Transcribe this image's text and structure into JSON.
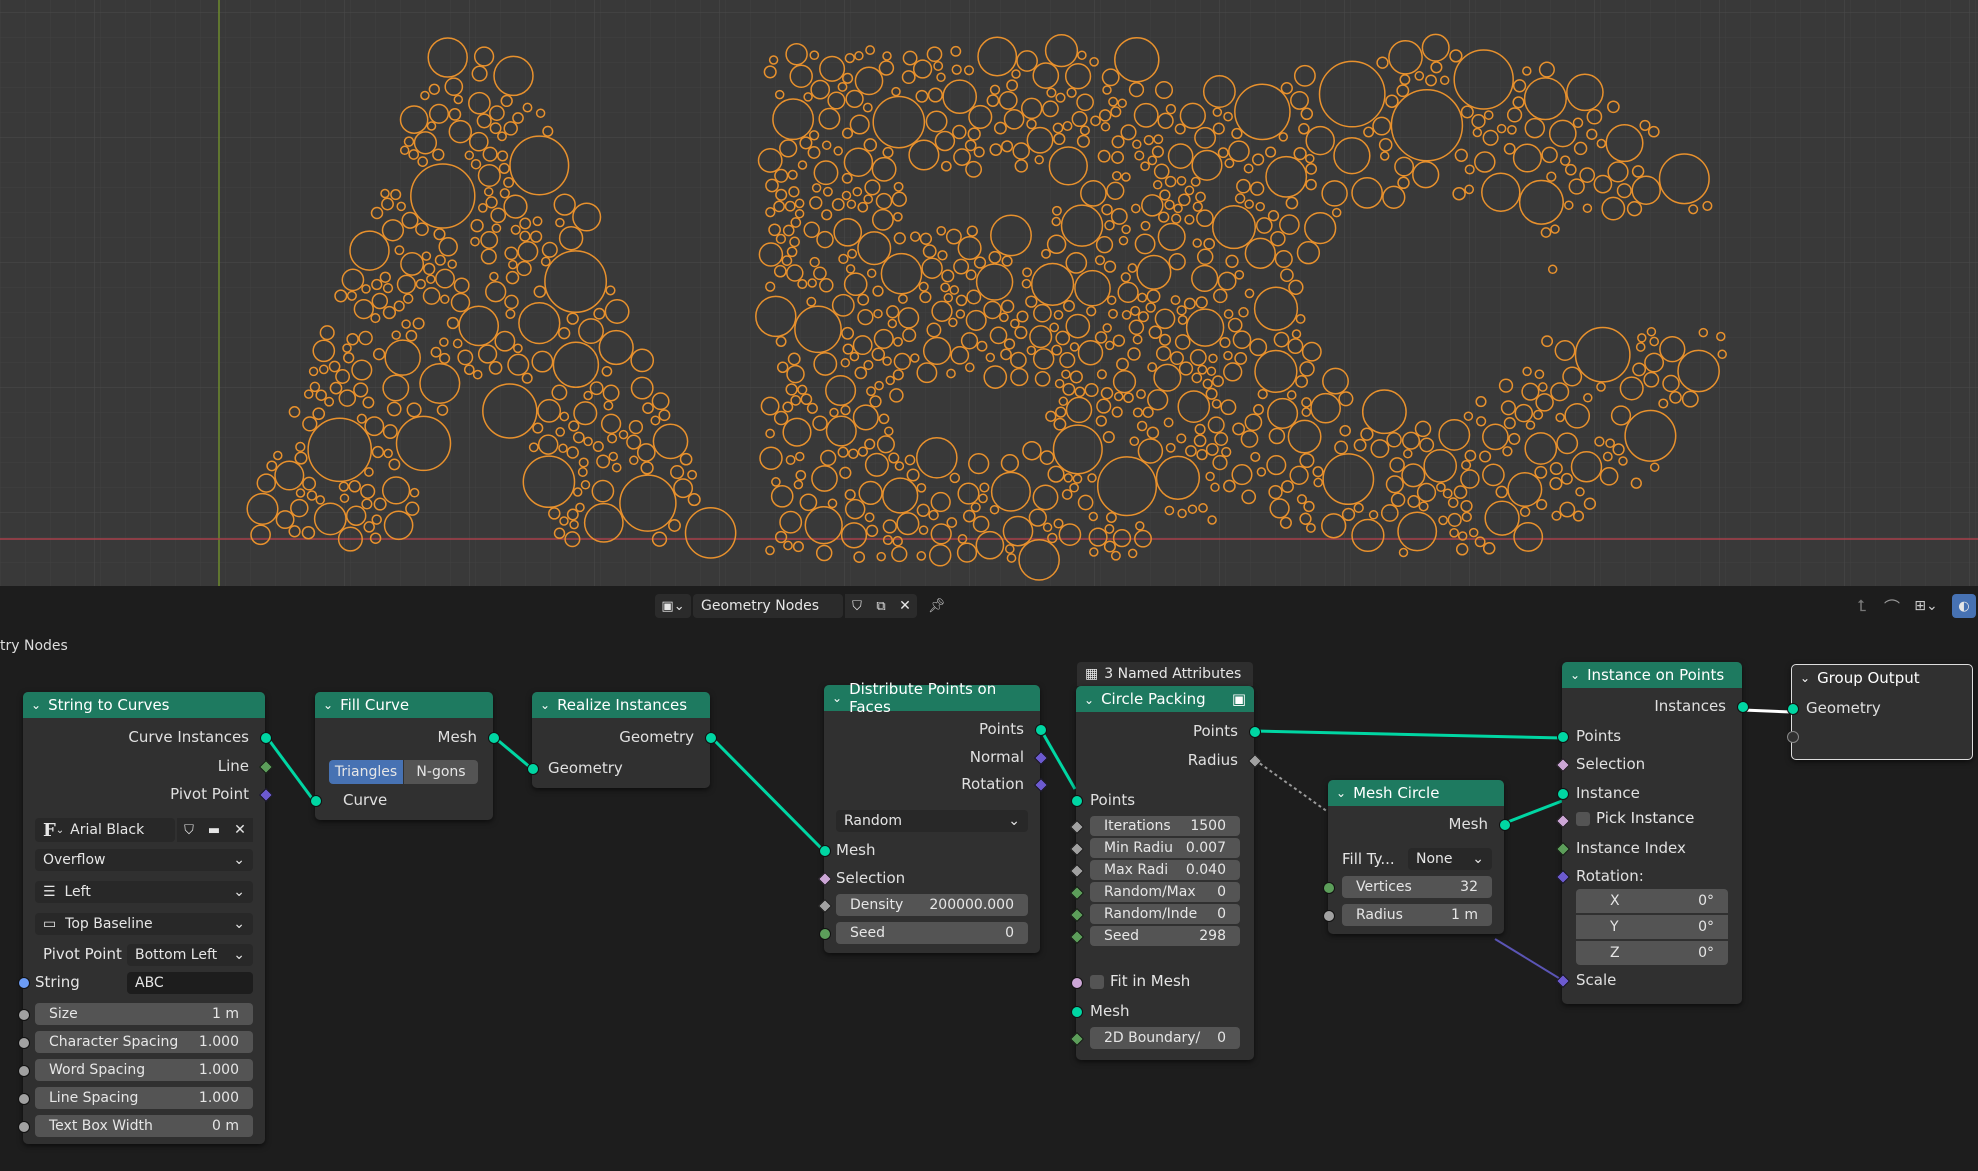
{
  "viewport": {
    "letters": "ABC"
  },
  "header": {
    "editor_type_icon": "node-editor-icon",
    "tree_name": "Geometry Nodes",
    "breadcrumb": "try Nodes"
  },
  "nodes": {
    "string_to_curves": {
      "title": "String to Curves",
      "outputs": [
        "Curve Instances",
        "Line",
        "Pivot Point"
      ],
      "font": "Arial Black",
      "overflow": "Overflow",
      "align_x": "Left",
      "align_y": "Top Baseline",
      "pivot_label": "Pivot Point",
      "pivot_value": "Bottom Left",
      "string_label": "String",
      "string_value": "ABC",
      "fields": [
        {
          "label": "Size",
          "value": "1 m"
        },
        {
          "label": "Character Spacing",
          "value": "1.000"
        },
        {
          "label": "Word Spacing",
          "value": "1.000"
        },
        {
          "label": "Line Spacing",
          "value": "1.000"
        },
        {
          "label": "Text Box Width",
          "value": "0 m"
        }
      ]
    },
    "fill_curve": {
      "title": "Fill Curve",
      "output": "Mesh",
      "mode_a": "Triangles",
      "mode_b": "N-gons",
      "input": "Curve"
    },
    "realize": {
      "title": "Realize Instances",
      "output": "Geometry",
      "input": "Geometry"
    },
    "distribute": {
      "title": "Distribute Points on Faces",
      "outputs": [
        "Points",
        "Normal",
        "Rotation"
      ],
      "mode": "Random",
      "inputs": [
        "Mesh",
        "Selection"
      ],
      "density_label": "Density",
      "density_value": "200000.000",
      "seed_label": "Seed",
      "seed_value": "0"
    },
    "circle_packing": {
      "attributes": "3 Named Attributes",
      "title": "Circle Packing",
      "outputs": [
        "Points",
        "Radius"
      ],
      "points_in": "Points",
      "fields": [
        {
          "label": "Iterations",
          "value": "1500"
        },
        {
          "label": "Min Radiu",
          "value": "0.007"
        },
        {
          "label": "Max Radi",
          "value": "0.040"
        },
        {
          "label": "Random/Max",
          "value": "0"
        },
        {
          "label": "Random/Inde",
          "value": "0"
        },
        {
          "label": "Seed",
          "value": "298"
        }
      ],
      "fit_label": "Fit in Mesh",
      "mesh_in": "Mesh",
      "boundary_label": "2D Boundary/",
      "boundary_value": "0"
    },
    "mesh_circle": {
      "title": "Mesh Circle",
      "output": "Mesh",
      "fill_label": "Fill Ty...",
      "fill_value": "None",
      "vertices_label": "Vertices",
      "vertices_value": "32",
      "radius_label": "Radius",
      "radius_value": "1 m"
    },
    "instance_on_points": {
      "title": "Instance on Points",
      "output": "Instances",
      "inputs": [
        "Points",
        "Selection",
        "Instance"
      ],
      "pick_label": "Pick Instance",
      "index_label": "Instance Index",
      "rotation_label": "Rotation:",
      "rot": [
        {
          "axis": "X",
          "value": "0°"
        },
        {
          "axis": "Y",
          "value": "0°"
        },
        {
          "axis": "Z",
          "value": "0°"
        }
      ],
      "scale_label": "Scale"
    },
    "group_output": {
      "title": "Group Output",
      "input": "Geometry"
    }
  },
  "colors": {
    "node_header": "#1e7a60",
    "link": "#00d6a3",
    "circle": "#e8912d",
    "viewport_bg": "#393939",
    "editor_bg": "#1d1d1d"
  }
}
